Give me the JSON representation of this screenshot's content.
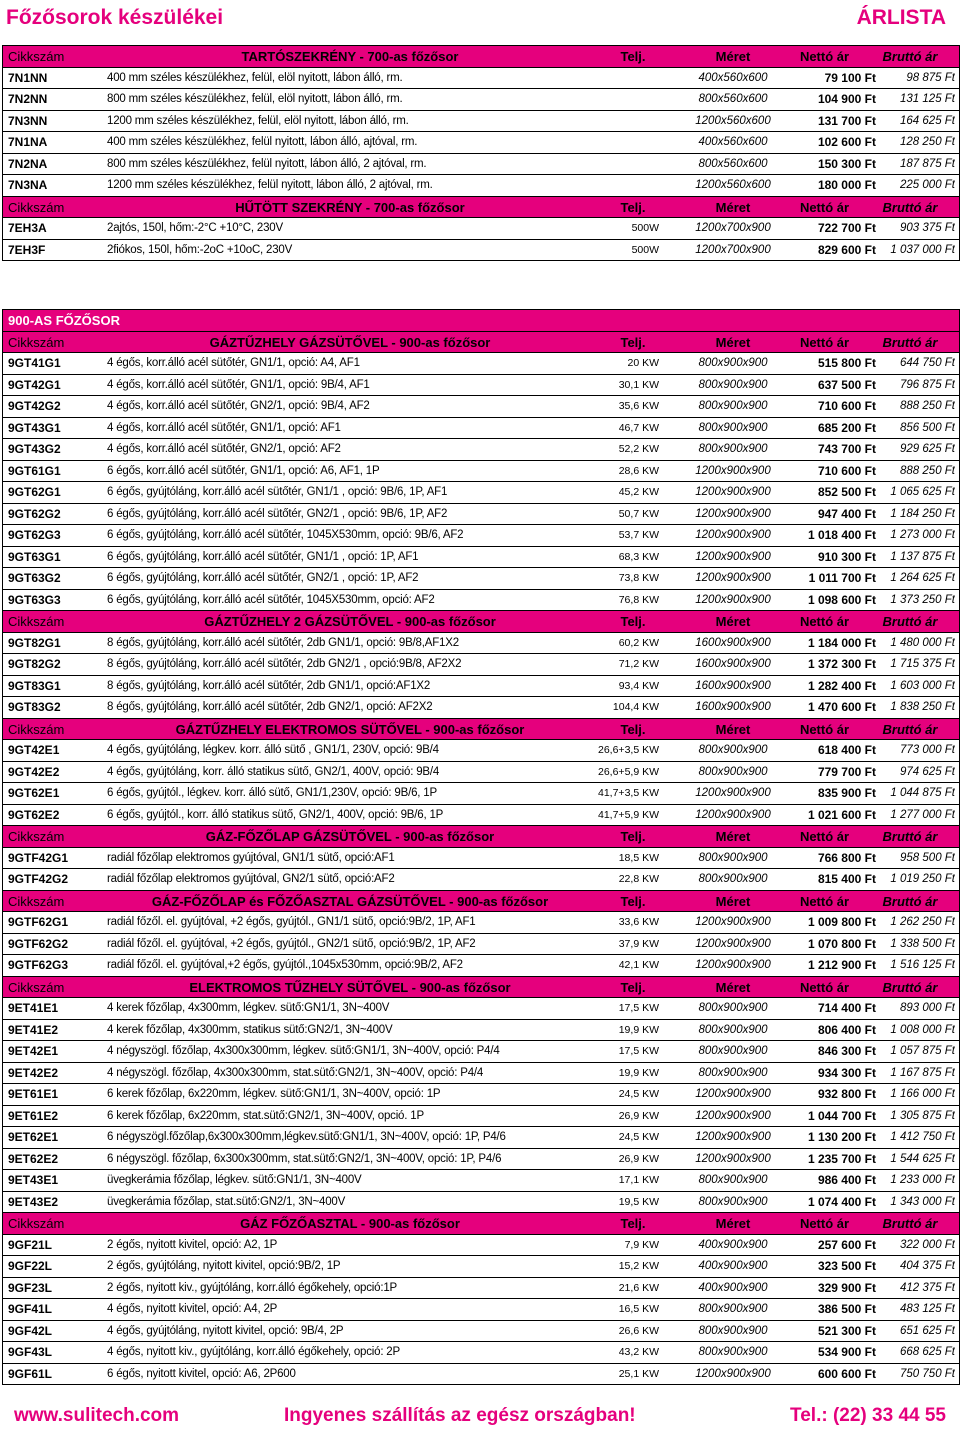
{
  "header": {
    "title": "Főzősorok készülékei",
    "right": "ÁRLISTA"
  },
  "table1": {
    "rows": [
      {
        "kind": "head",
        "code": "Cikkszám",
        "title": "TARTÓSZEKRÉNY - 700-as főzősor",
        "telj": "Telj.",
        "size": "Méret",
        "net": "Nettó ár",
        "gross": "Bruttó ár"
      },
      {
        "kind": "data",
        "code": "7N1NN",
        "desc": "400 mm széles készülékhez, felül, elöl nyitott, lábon álló, rm.",
        "pow": "",
        "size": "400x560x600",
        "net": "79 100 Ft",
        "gross": "98 875 Ft"
      },
      {
        "kind": "data",
        "code": "7N2NN",
        "desc": "800 mm széles készülékhez, felül, elöl nyitott, lábon álló, rm.",
        "pow": "",
        "size": "800x560x600",
        "net": "104 900 Ft",
        "gross": "131 125 Ft"
      },
      {
        "kind": "data",
        "code": "7N3NN",
        "desc": "1200 mm széles készülékhez, felül, elöl nyitott, lábon álló, rm.",
        "pow": "",
        "size": "1200x560x600",
        "net": "131 700 Ft",
        "gross": "164 625 Ft"
      },
      {
        "kind": "data",
        "code": "7N1NA",
        "desc": "400 mm széles készülékhez, felül nyitott, lábon álló, ajtóval, rm.",
        "pow": "",
        "size": "400x560x600",
        "net": "102 600 Ft",
        "gross": "128 250 Ft"
      },
      {
        "kind": "data",
        "code": "7N2NA",
        "desc": "800 mm széles készülékhez, felül nyitott, lábon álló, 2 ajtóval, rm.",
        "pow": "",
        "size": "800x560x600",
        "net": "150 300 Ft",
        "gross": "187 875 Ft"
      },
      {
        "kind": "data",
        "code": "7N3NA",
        "desc": "1200 mm széles készülékhez, felül nyitott, lábon álló, 2 ajtóval, rm.",
        "pow": "",
        "size": "1200x560x600",
        "net": "180 000 Ft",
        "gross": "225 000 Ft"
      },
      {
        "kind": "head",
        "code": "Cikkszám",
        "title": "HŰTÖTT SZEKRÉNY - 700-as főzősor",
        "telj": "Telj.",
        "size": "Méret",
        "net": "Nettó ár",
        "gross": "Bruttó ár"
      },
      {
        "kind": "data",
        "code": "7EH3A",
        "desc": "2ajtós, 150l, hőm:-2°C +10°C, 230V",
        "pow": "500W",
        "size": "1200x700x900",
        "net": "722 700 Ft",
        "gross": "903 375 Ft"
      },
      {
        "kind": "data",
        "code": "7EH3F",
        "desc": "2fiókos, 150l, hőm:-2oC +10oC, 230V",
        "pow": "500W",
        "size": "1200x700x900",
        "net": "829 600 Ft",
        "gross": "1 037 000 Ft"
      }
    ]
  },
  "table2": {
    "rows": [
      {
        "kind": "sec",
        "text": "900-AS FŐZŐSOR"
      },
      {
        "kind": "head",
        "code": "Cikkszám",
        "title": "GÁZTŰZHELY GÁZSÜTŐVEL - 900-as főzősor",
        "telj": "Telj.",
        "size": "Méret",
        "net": "Nettó ár",
        "gross": "Bruttó ár"
      },
      {
        "kind": "data",
        "code": "9GT41G1",
        "desc": "4 égős, korr.álló acél sütőtér, GN1/1, opció: A4, AF1",
        "pow": "20 KW",
        "size": "800x900x900",
        "net": "515 800 Ft",
        "gross": "644 750 Ft"
      },
      {
        "kind": "data",
        "code": "9GT42G1",
        "desc": "4 égős, korr.álló acél sütőtér, GN1/1, opció: 9B/4, AF1",
        "pow": "30,1 KW",
        "size": "800x900x900",
        "net": "637 500 Ft",
        "gross": "796 875 Ft"
      },
      {
        "kind": "data",
        "code": "9GT42G2",
        "desc": "4 égős, korr.álló acél sütőtér, GN2/1, opció: 9B/4, AF2",
        "pow": "35,6 KW",
        "size": "800x900x900",
        "net": "710 600 Ft",
        "gross": "888 250 Ft"
      },
      {
        "kind": "data",
        "code": "9GT43G1",
        "desc": "4 égős, korr.álló acél sütőtér, GN1/1, opció: AF1",
        "pow": "46,7 KW",
        "size": "800x900x900",
        "net": "685 200 Ft",
        "gross": "856 500 Ft"
      },
      {
        "kind": "data",
        "code": "9GT43G2",
        "desc": "4 égős, korr.álló acél sütőtér, GN2/1, opció: AF2",
        "pow": "52,2 KW",
        "size": "800x900x900",
        "net": "743 700 Ft",
        "gross": "929 625 Ft"
      },
      {
        "kind": "data",
        "code": "9GT61G1",
        "desc": "6 égős, korr.álló acél sütőtér, GN1/1, opció: A6, AF1, 1P",
        "pow": "28,6 KW",
        "size": "1200x900x900",
        "net": "710 600 Ft",
        "gross": "888 250 Ft"
      },
      {
        "kind": "data",
        "code": "9GT62G1",
        "desc": "6 égős, gyújtóláng, korr.álló acél sütőtér, GN1/1 , opció: 9B/6, 1P, AF1",
        "pow": "45,2 KW",
        "size": "1200x900x900",
        "net": "852 500 Ft",
        "gross": "1 065 625 Ft"
      },
      {
        "kind": "data",
        "code": "9GT62G2",
        "desc": "6 égős, gyújtóláng, korr.álló acél sütőtér, GN2/1 , opció: 9B/6, 1P, AF2",
        "pow": "50,7 KW",
        "size": "1200x900x900",
        "net": "947 400 Ft",
        "gross": "1 184 250 Ft"
      },
      {
        "kind": "data",
        "code": "9GT62G3",
        "desc": "6 égős, gyújtóláng, korr.álló acél sütőtér, 1045X530mm, opció: 9B/6, AF2",
        "pow": "53,7 KW",
        "size": "1200x900x900",
        "net": "1 018 400 Ft",
        "gross": "1 273 000 Ft"
      },
      {
        "kind": "data",
        "code": "9GT63G1",
        "desc": "6 égős, gyújtóláng, korr.álló acél sütőtér, GN1/1 , opció: 1P, AF1",
        "pow": "68,3 KW",
        "size": "1200x900x900",
        "net": "910 300 Ft",
        "gross": "1 137 875 Ft"
      },
      {
        "kind": "data",
        "code": "9GT63G2",
        "desc": "6 égős, gyújtóláng, korr.álló acél sütőtér, GN2/1 , opció: 1P, AF2",
        "pow": "73,8 KW",
        "size": "1200x900x900",
        "net": "1 011 700 Ft",
        "gross": "1 264 625 Ft"
      },
      {
        "kind": "data",
        "code": "9GT63G3",
        "desc": "6 égős, gyújtóláng, korr.álló acél sütőtér, 1045X530mm, opció: AF2",
        "pow": "76,8 KW",
        "size": "1200x900x900",
        "net": "1 098 600 Ft",
        "gross": "1 373 250 Ft"
      },
      {
        "kind": "head",
        "code": "Cikkszám",
        "title": "GÁZTŰZHELY 2 GÁZSÜTŐVEL - 900-as főzősor",
        "telj": "Telj.",
        "size": "Méret",
        "net": "Nettó ár",
        "gross": "Bruttó ár"
      },
      {
        "kind": "data",
        "code": "9GT82G1",
        "desc": "8 égős, gyújtóláng, korr.álló acél sütőtér,  2db GN1/1, opció: 9B/8,AF1X2",
        "pow": "60,2 KW",
        "size": "1600x900x900",
        "net": "1 184 000 Ft",
        "gross": "1 480 000 Ft"
      },
      {
        "kind": "data",
        "code": "9GT82G2",
        "desc": "8 égős, gyújtóláng, korr.álló acél sütőtér,  2db GN2/1 , opció:9B/8, AF2X2",
        "pow": "71,2 KW",
        "size": "1600x900x900",
        "net": "1 372 300 Ft",
        "gross": "1 715 375 Ft"
      },
      {
        "kind": "data",
        "code": "9GT83G1",
        "desc": "8 égős, gyújtóláng, korr.álló acél sütőtér,  2db GN1/1, opció:AF1X2",
        "pow": "93,4 KW",
        "size": "1600x900x900",
        "net": "1 282 400 Ft",
        "gross": "1 603 000 Ft"
      },
      {
        "kind": "data",
        "code": "9GT83G2",
        "desc": "8 égős, gyújtóláng, korr.álló acél sütőtér,  2db GN2/1, opció: AF2X2",
        "pow": "104,4 KW",
        "size": "1600x900x900",
        "net": "1 470 600 Ft",
        "gross": "1 838 250 Ft"
      },
      {
        "kind": "head",
        "code": "Cikkszám",
        "title": "GÁZTŰZHELY ELEKTROMOS SÜTŐVEL - 900-as főzősor",
        "telj": "Telj.",
        "size": "Méret",
        "net": "Nettó ár",
        "gross": "Bruttó ár"
      },
      {
        "kind": "data",
        "code": "9GT42E1",
        "desc": "4 égős, gyújtóláng, légkev. korr. álló sütő , GN1/1, 230V, opció: 9B/4",
        "pow": "26,6+3,5 KW",
        "size": "800x900x900",
        "net": "618 400 Ft",
        "gross": "773 000 Ft"
      },
      {
        "kind": "data",
        "code": "9GT42E2",
        "desc": "4 égős, gyújtóláng, korr. álló statikus sütő, GN2/1, 400V, opció: 9B/4",
        "pow": "26,6+5,9 KW",
        "size": "800x900x900",
        "net": "779 700 Ft",
        "gross": "974 625 Ft"
      },
      {
        "kind": "data",
        "code": "9GT62E1",
        "desc": "6 égős, gyújtól., légkev. korr. álló sütő, GN1/1,230V, opció: 9B/6, 1P",
        "pow": "41,7+3,5 KW",
        "size": "1200x900x900",
        "net": "835 900 Ft",
        "gross": "1 044 875 Ft"
      },
      {
        "kind": "data",
        "code": "9GT62E2",
        "desc": "6 égős, gyújtól., korr. álló statikus sütő, GN2/1, 400V, opció: 9B/6, 1P",
        "pow": "41,7+5,9 KW",
        "size": "1200x900x900",
        "net": "1 021 600 Ft",
        "gross": "1 277 000 Ft"
      },
      {
        "kind": "head",
        "code": "Cikkszám",
        "title": "GÁZ-FŐZŐLAP GÁZSÜTŐVEL - 900-as főzősor",
        "telj": "Telj.",
        "size": "Méret",
        "net": "Nettó ár",
        "gross": "Bruttó ár"
      },
      {
        "kind": "data",
        "code": "9GTF42G1",
        "desc": "radiál főzőlap elektromos gyújtóval, GN1/1 sütő, opció:AF1",
        "pow": "18,5 KW",
        "size": "800x900x900",
        "net": "766 800 Ft",
        "gross": "958 500 Ft"
      },
      {
        "kind": "data",
        "code": "9GTF42G2",
        "desc": "radiál főzőlap elektromos gyújtóval, GN2/1 sütő, opció:AF2",
        "pow": "22,8 KW",
        "size": "800x900x900",
        "net": "815 400 Ft",
        "gross": "1 019 250 Ft"
      },
      {
        "kind": "head",
        "code": "Cikkszám",
        "title": "GÁZ-FŐZŐLAP és FŐZŐASZTAL GÁZSÜTŐVEL - 900-as főzősor",
        "telj": "Telj.",
        "size": "Méret",
        "net": "Nettó ár",
        "gross": "Bruttó ár"
      },
      {
        "kind": "data",
        "code": "9GTF62G1",
        "desc": "radiál főzől. el. gyújtóval, +2 égős, gyújtól., GN1/1 sütő, opció:9B/2, 1P, AF1",
        "pow": "33,6 KW",
        "size": "1200x900x900",
        "net": "1 009 800 Ft",
        "gross": "1 262 250 Ft"
      },
      {
        "kind": "data",
        "code": "9GTF62G2",
        "desc": "radiál főzől. el. gyújtóval, +2 égős, gyújtól., GN2/1 sütő, opció:9B/2, 1P, AF2",
        "pow": "37,9 KW",
        "size": "1200x900x900",
        "net": "1 070 800 Ft",
        "gross": "1 338 500 Ft"
      },
      {
        "kind": "data",
        "code": "9GTF62G3",
        "desc": "radiál főzől. el. gyújtóval,+2 égős, gyújtól.,1045x530mm, opció:9B/2, AF2",
        "pow": "42,1 KW",
        "size": "1200x900x900",
        "net": "1 212 900 Ft",
        "gross": "1 516 125 Ft"
      },
      {
        "kind": "head",
        "code": "Cikkszám",
        "title": "ELEKTROMOS TŰZHELY SÜTŐVEL - 900-as főzősor",
        "telj": "Telj.",
        "size": "Méret",
        "net": "Nettó ár",
        "gross": "Bruttó ár"
      },
      {
        "kind": "data",
        "code": "9ET41E1",
        "desc": "4 kerek főzőlap, 4x300mm, légkev. sütő:GN1/1, 3N~400V",
        "pow": "17,5 KW",
        "size": "800x900x900",
        "net": "714 400 Ft",
        "gross": "893 000 Ft"
      },
      {
        "kind": "data",
        "code": "9ET41E2",
        "desc": "4 kerek főzőlap, 4x300mm, statikus sütő:GN2/1, 3N~400V",
        "pow": "19,9 KW",
        "size": "800x900x900",
        "net": "806 400 Ft",
        "gross": "1 008 000 Ft"
      },
      {
        "kind": "data",
        "code": "9ET42E1",
        "desc": "4 négyszögl. főzőlap, 4x300x300mm, légkev. sütő:GN1/1, 3N~400V, opció: P4/4",
        "pow": "17,5 KW",
        "size": "800x900x900",
        "net": "846 300 Ft",
        "gross": "1 057 875 Ft"
      },
      {
        "kind": "data",
        "code": "9ET42E2",
        "desc": "4 négyszögl. főzőlap, 4x300x300mm, stat.sütő:GN2/1, 3N~400V, opció: P4/4",
        "pow": "19,9 KW",
        "size": "800x900x900",
        "net": "934 300 Ft",
        "gross": "1 167 875 Ft"
      },
      {
        "kind": "data",
        "code": "9ET61E1",
        "desc": "6 kerek főzőlap, 6x220mm, légkev. sütő:GN1/1, 3N~400V, opció: 1P",
        "pow": "24,5 KW",
        "size": "1200x900x900",
        "net": "932 800 Ft",
        "gross": "1 166 000 Ft"
      },
      {
        "kind": "data",
        "code": "9ET61E2",
        "desc": "6 kerek főzőlap, 6x220mm, stat.sütő:GN2/1, 3N~400V, opció. 1P",
        "pow": "26,9 KW",
        "size": "1200x900x900",
        "net": "1 044 700 Ft",
        "gross": "1 305 875 Ft"
      },
      {
        "kind": "data",
        "code": "9ET62E1",
        "desc": "6 négyszögl.főzőlap,6x300x300mm,légkev.sütő:GN1/1, 3N~400V, opció: 1P, P4/6",
        "pow": "24,5  KW",
        "size": "1200x900x900",
        "net": "1 130 200 Ft",
        "gross": "1 412 750 Ft"
      },
      {
        "kind": "data",
        "code": "9ET62E2",
        "desc": "6 négyszögl. főzőlap, 6x300x300mm, stat.sütő:GN2/1, 3N~400V, opció: 1P, P4/6",
        "pow": "26,9 KW",
        "size": "1200x900x900",
        "net": "1 235 700 Ft",
        "gross": "1 544 625 Ft"
      },
      {
        "kind": "data",
        "code": "9ET43E1",
        "desc": "üvegkerámia főzőlap, légkev. sütő:GN1/1, 3N~400V",
        "pow": "17,1 KW",
        "size": "800x900x900",
        "net": "986 400 Ft",
        "gross": "1 233 000 Ft"
      },
      {
        "kind": "data",
        "code": "9ET43E2",
        "desc": "üvegkerámia főzőlap, stat.sütő:GN2/1, 3N~400V",
        "pow": "19,5 KW",
        "size": "800x900x900",
        "net": "1 074 400 Ft",
        "gross": "1 343 000 Ft"
      },
      {
        "kind": "head",
        "code": "Cikkszám",
        "title": "GÁZ FŐZŐASZTAL - 900-as főzősor",
        "telj": "Telj.",
        "size": "Méret",
        "net": "Nettó ár",
        "gross": "Bruttó ár"
      },
      {
        "kind": "data",
        "code": "9GF21L",
        "desc": "2 égős, nyitott kivitel, opció: A2, 1P",
        "pow": "7,9 KW",
        "size": "400x900x900",
        "net": "257 600 Ft",
        "gross": "322 000 Ft"
      },
      {
        "kind": "data",
        "code": "9GF22L",
        "desc": "2 égős, gyújtóláng, nyitott kivitel, opció:9B/2, 1P",
        "pow": "15,2 KW",
        "size": "400x900x900",
        "net": "323 500 Ft",
        "gross": "404 375 Ft"
      },
      {
        "kind": "data",
        "code": "9GF23L",
        "desc": "2 égős, nyitott kiv., gyújtóláng, korr.álló égőkehely, opció:1P",
        "pow": "21,6 KW",
        "size": "400x900x900",
        "net": "329 900 Ft",
        "gross": "412 375 Ft"
      },
      {
        "kind": "data",
        "code": "9GF41L",
        "desc": "4 égős, nyitott kivitel, opció: A4, 2P",
        "pow": "16,5 KW",
        "size": "800x900x900",
        "net": "386 500 Ft",
        "gross": "483 125 Ft"
      },
      {
        "kind": "data",
        "code": "9GF42L",
        "desc": "4 égős, gyújtóláng, nyitott kivitel, opció: 9B/4, 2P",
        "pow": "26,6 KW",
        "size": "800x900x900",
        "net": "521 300 Ft",
        "gross": "651 625 Ft"
      },
      {
        "kind": "data",
        "code": "9GF43L",
        "desc": "4 égős, nyitott kiv., gyújtóláng, korr.álló égőkehely, opció: 2P",
        "pow": "43,2 KW",
        "size": "800x900x900",
        "net": "534 900 Ft",
        "gross": "668 625 Ft"
      },
      {
        "kind": "data",
        "code": "9GF61L",
        "desc": "6 égős, nyitott kivitel, opció: A6, 2P600",
        "pow": "25,1 KW",
        "size": "1200x900x900",
        "net": "600 600 Ft",
        "gross": "750 750 Ft"
      }
    ]
  },
  "footer": {
    "website": "www.sulitech.com",
    "shipping": "Ingyenes szállítás az egész országban!",
    "phone": "Tel.: (22) 33 44 55"
  },
  "colors": {
    "accent": "#e5007d"
  }
}
